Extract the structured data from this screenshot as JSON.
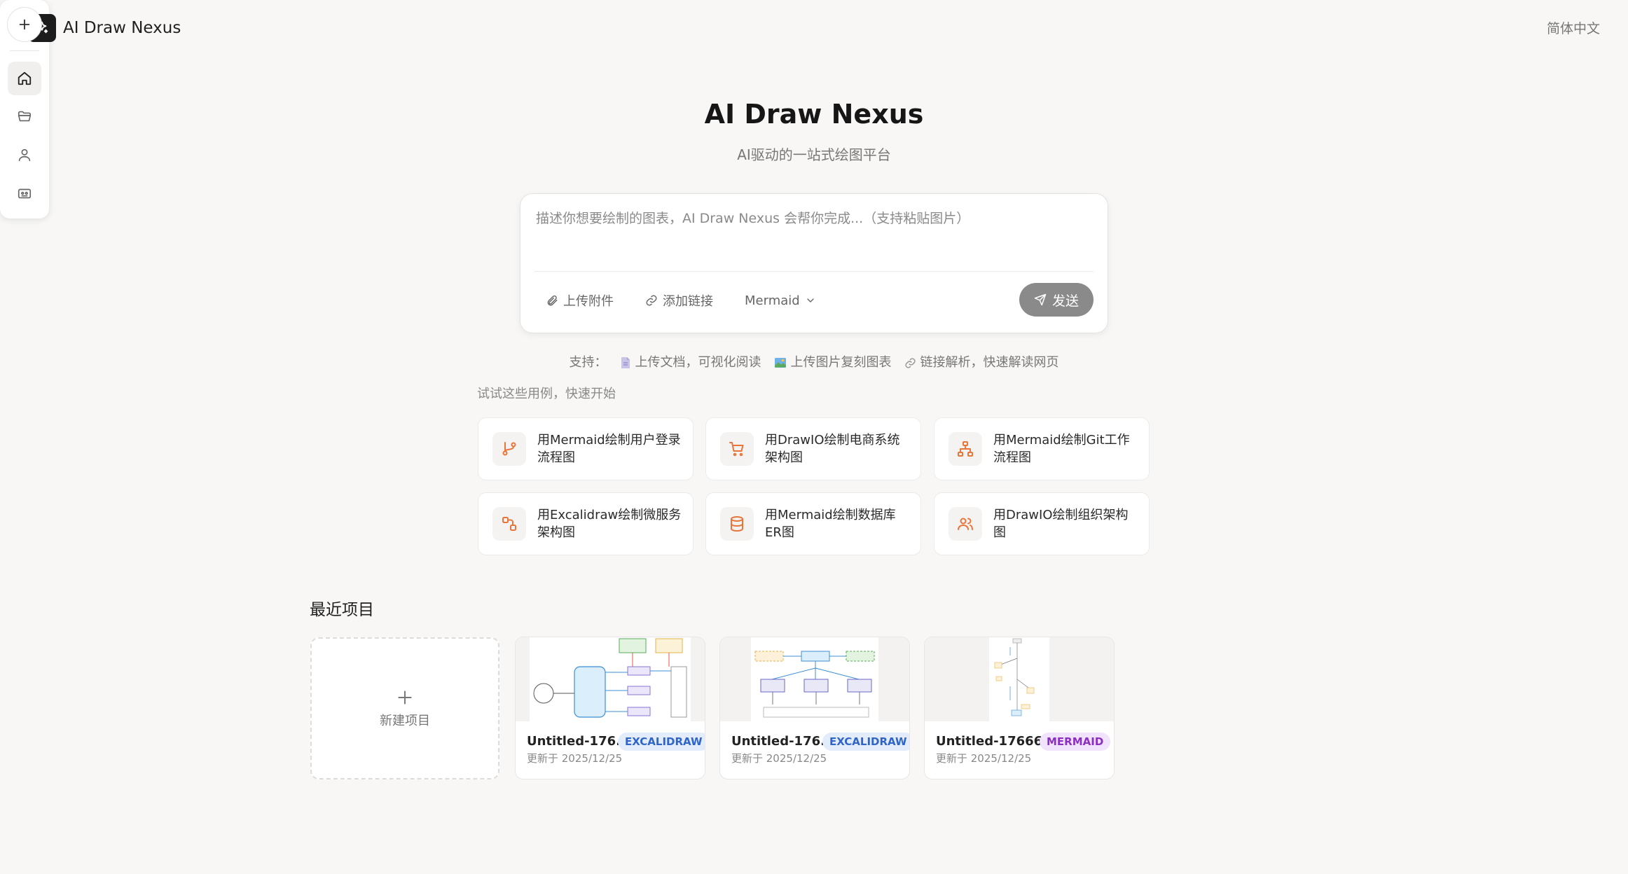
{
  "header": {
    "app_name": "AI Draw Nexus",
    "language": "简体中文"
  },
  "sidebar": {
    "items": [
      {
        "name": "new",
        "icon": "plus-icon"
      },
      {
        "name": "home",
        "icon": "home-icon",
        "active": true
      },
      {
        "name": "projects",
        "icon": "folder-icon"
      },
      {
        "name": "profile",
        "icon": "user-icon"
      },
      {
        "name": "models",
        "icon": "robot-icon"
      }
    ]
  },
  "hero": {
    "title": "AI Draw Nexus",
    "subtitle": "AI驱动的一站式绘图平台"
  },
  "prompt": {
    "placeholder": "描述你想要绘制的图表，AI Draw Nexus 会帮你完成...（支持粘贴图片）",
    "value": "",
    "upload_label": "上传附件",
    "link_label": "添加链接",
    "engine": "Mermaid",
    "send_label": "发送"
  },
  "support": {
    "label": "支持：",
    "items": [
      "上传文档，可视化阅读",
      "上传图片复刻图表",
      "链接解析，快速解读网页"
    ]
  },
  "examples": {
    "label": "试试这些用例，快速开始",
    "items": [
      {
        "text": "用Mermaid绘制用户登录流程图",
        "icon": "git-branch-icon"
      },
      {
        "text": "用DrawIO绘制电商系统架构图",
        "icon": "cart-icon"
      },
      {
        "text": "用Mermaid绘制Git工作流程图",
        "icon": "hierarchy-icon"
      },
      {
        "text": "用Excalidraw绘制微服务架构图",
        "icon": "workflow-icon"
      },
      {
        "text": "用Mermaid绘制数据库ER图",
        "icon": "database-icon"
      },
      {
        "text": "用DrawIO绘制组织架构图",
        "icon": "users-icon"
      }
    ]
  },
  "recent": {
    "title": "最近项目",
    "new_label": "新建项目",
    "projects": [
      {
        "name": "Untitled-176...",
        "type": "EXCALIDRAW",
        "updated": "更新于 2025/12/25"
      },
      {
        "name": "Untitled-176...",
        "type": "EXCALIDRAW",
        "updated": "更新于 2025/12/25"
      },
      {
        "name": "Untitled-17666...",
        "type": "MERMAID",
        "updated": "更新于 2025/12/25"
      }
    ]
  },
  "colors": {
    "accent": "#e8763a",
    "background": "#f8f7f5",
    "send_button": "#8a8a8a"
  }
}
